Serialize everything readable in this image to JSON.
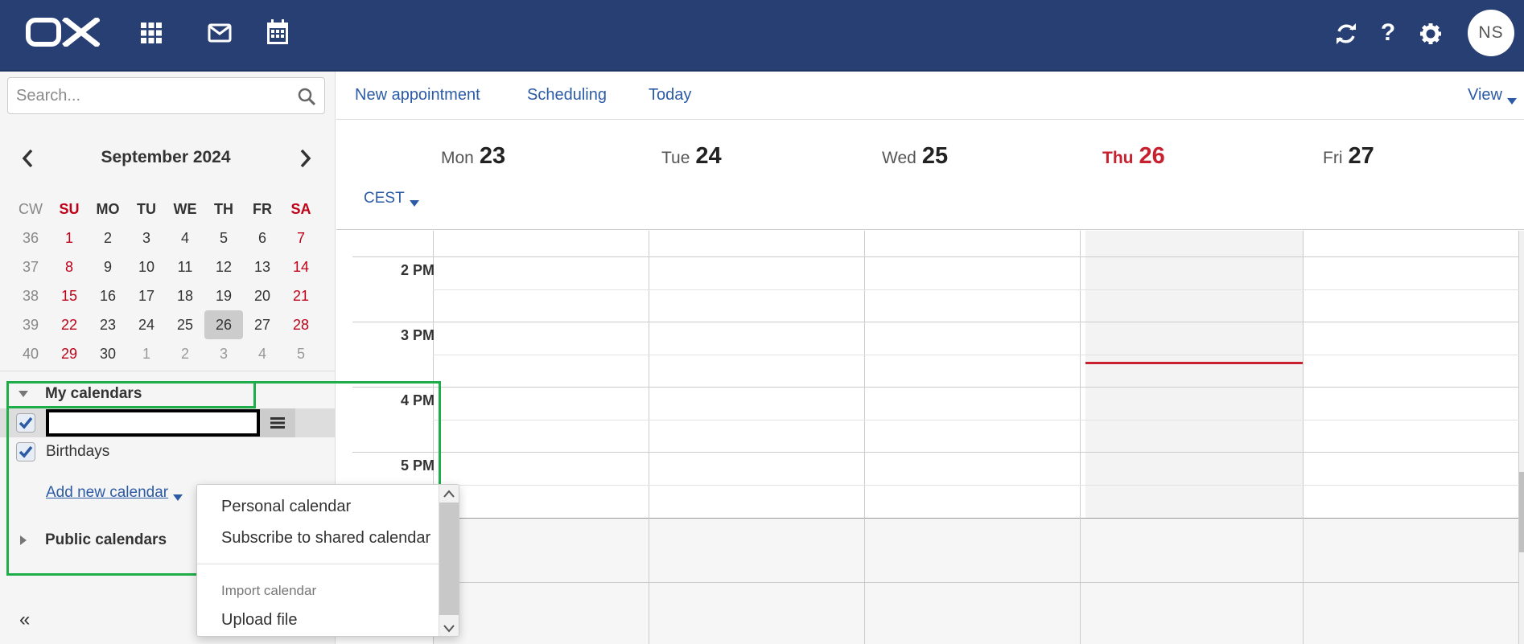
{
  "topbar": {
    "logo_text": "OX",
    "avatar_initials": "NS",
    "icons": [
      "apps-grid-icon",
      "mail-icon",
      "calendar-icon",
      "refresh-icon",
      "help-icon",
      "settings-gear-icon"
    ],
    "help_glyph": "?",
    "background": "#283f73"
  },
  "search": {
    "placeholder": "Search..."
  },
  "mini_calendar": {
    "title": "September 2024",
    "headers": [
      "CW",
      "SU",
      "MO",
      "TU",
      "WE",
      "TH",
      "FR",
      "SA"
    ],
    "weeks": [
      [
        "36",
        "1",
        "2",
        "3",
        "4",
        "5",
        "6",
        "7"
      ],
      [
        "37",
        "8",
        "9",
        "10",
        "11",
        "12",
        "13",
        "14"
      ],
      [
        "38",
        "15",
        "16",
        "17",
        "18",
        "19",
        "20",
        "21"
      ],
      [
        "39",
        "22",
        "23",
        "24",
        "25",
        "26",
        "27",
        "28"
      ],
      [
        "40",
        "29",
        "30",
        "1",
        "2",
        "3",
        "4",
        "5"
      ]
    ],
    "selected_day": "26",
    "weekend_color": "#c00018"
  },
  "folders": {
    "my_calendars_label": "My calendars",
    "birthdays_label": "Birthdays",
    "add_new_label": "Add new calendar",
    "public_calendars_label": "Public calendars",
    "collapse_label": "«"
  },
  "toolbar": {
    "new_appointment": "New appointment",
    "scheduling": "Scheduling",
    "today": "Today",
    "view": "View"
  },
  "week": {
    "days": [
      {
        "name": "Mon",
        "num": "23"
      },
      {
        "name": "Tue",
        "num": "24"
      },
      {
        "name": "Wed",
        "num": "25"
      },
      {
        "name": "Thu",
        "num": "26"
      },
      {
        "name": "Fri",
        "num": "27"
      }
    ],
    "today_index": 3,
    "timezone": "CEST",
    "hours": [
      "2 PM",
      "3 PM",
      "4 PM",
      "5 PM"
    ],
    "today_color": "#c8202e"
  },
  "dropdown": {
    "personal": "Personal calendar",
    "subscribe": "Subscribe to shared calendar",
    "import_header": "Import calendar",
    "upload": "Upload file"
  },
  "accent_color": "#2c5ba6",
  "highlight_color": "#1fad4a"
}
